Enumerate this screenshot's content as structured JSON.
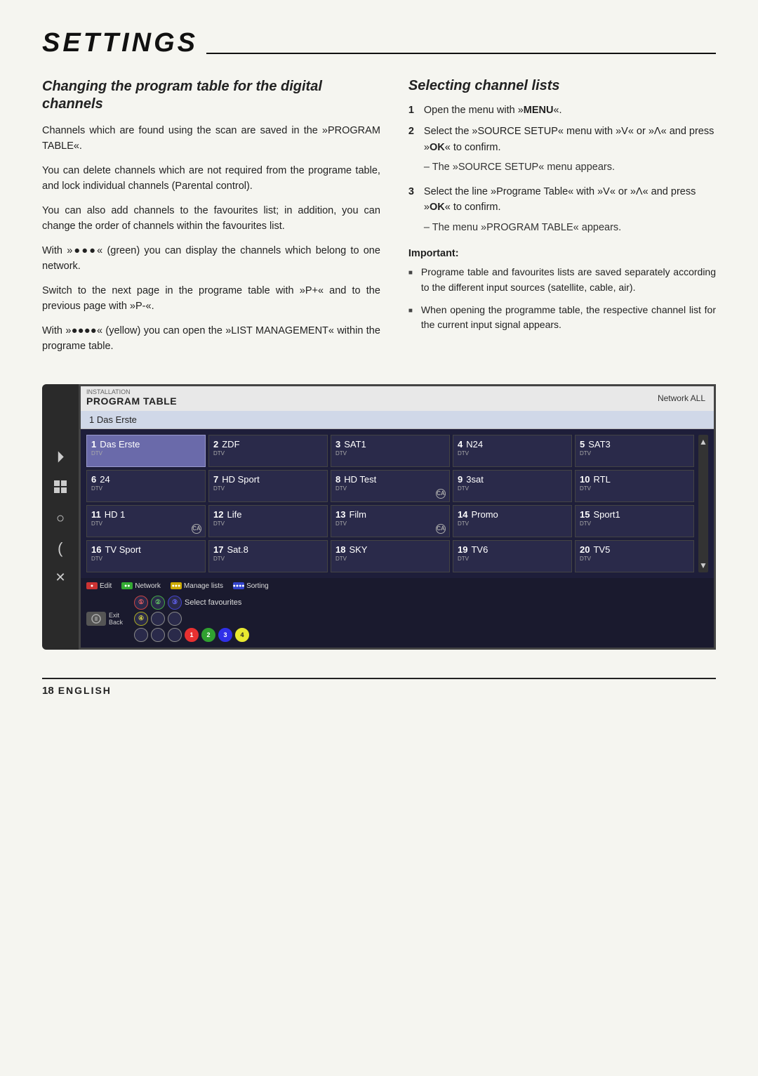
{
  "page": {
    "title": "SETTINGS",
    "footer": {
      "page_num": "18",
      "language": "ENGLISH"
    }
  },
  "left_col": {
    "heading": "Changing the program table for the digital channels",
    "paragraphs": [
      "Channels which are found using the scan are saved in the »PROGRAM TABLE«.",
      "You can delete channels which are not required from the programe table, and lock individual channels (Parental control).",
      "You can also add channels to the favourites list; in addition, you can change the order of channels within the favourites list.",
      "With »●●●« (green) you can display the channels which belong to one network.",
      "Switch to the next page in the programe table with »P+« and to the previous page with »P-«.",
      "With »●●●●« (yellow) you can open the »LIST MANAGEMENT« within the programe table."
    ]
  },
  "right_col": {
    "heading": "Selecting channel lists",
    "steps": [
      {
        "num": "1",
        "text": "Open the menu with »MENU«."
      },
      {
        "num": "2",
        "text": "Select the »SOURCE SETUP« menu with »V« or »Λ« and press »OK« to confirm.",
        "sub": "– The »SOURCE SETUP« menu appears."
      },
      {
        "num": "3",
        "text": "Select the line »Programe Table« with »V« or »Λ« and press »OK« to confirm.",
        "sub": "– The menu »PROGRAM TABLE« appears."
      }
    ],
    "important_label": "Important:",
    "bullets": [
      "Programe table and favourites lists are saved separately according to the different input sources (satellite, cable, air).",
      "When opening the programme table, the respective channel list for the current input signal appears."
    ]
  },
  "tv_screen": {
    "installation_label": "INSTALLATION",
    "program_table_label": "PROGRAM TABLE",
    "network_label": "Network ALL",
    "selected_channel": "1   Das Erste",
    "channels": [
      {
        "num": "1",
        "name": "Das Erste",
        "type": "DTV",
        "ca": false,
        "selected": true
      },
      {
        "num": "2",
        "name": "ZDF",
        "type": "DTV",
        "ca": false,
        "selected": false
      },
      {
        "num": "3",
        "name": "SAT1",
        "type": "DTV",
        "ca": false,
        "selected": false
      },
      {
        "num": "4",
        "name": "N24",
        "type": "DTV",
        "ca": false,
        "selected": false
      },
      {
        "num": "5",
        "name": "SAT3",
        "type": "DTV",
        "ca": false,
        "selected": false
      },
      {
        "num": "6",
        "name": "24",
        "type": "DTV",
        "ca": false,
        "selected": false
      },
      {
        "num": "7",
        "name": "HD Sport",
        "type": "DTV",
        "ca": false,
        "selected": false
      },
      {
        "num": "8",
        "name": "HD Test",
        "type": "DTV",
        "ca": true,
        "selected": false
      },
      {
        "num": "9",
        "name": "3sat",
        "type": "DTV",
        "ca": false,
        "selected": false
      },
      {
        "num": "10",
        "name": "RTL",
        "type": "DTV",
        "ca": false,
        "selected": false
      },
      {
        "num": "11",
        "name": "HD 1",
        "type": "DTV",
        "ca": true,
        "selected": false
      },
      {
        "num": "12",
        "name": "Life",
        "type": "DTV",
        "ca": false,
        "selected": false
      },
      {
        "num": "13",
        "name": "Film",
        "type": "DTV",
        "ca": true,
        "selected": false
      },
      {
        "num": "14",
        "name": "Promo",
        "type": "DTV",
        "ca": false,
        "selected": false
      },
      {
        "num": "15",
        "name": "Sport1",
        "type": "DTV",
        "ca": false,
        "selected": false
      },
      {
        "num": "16",
        "name": "TV Sport",
        "type": "DTV",
        "ca": false,
        "selected": false
      },
      {
        "num": "17",
        "name": "Sat.8",
        "type": "DTV",
        "ca": false,
        "selected": false
      },
      {
        "num": "18",
        "name": "SKY",
        "type": "DTV",
        "ca": false,
        "selected": false
      },
      {
        "num": "19",
        "name": "TV6",
        "type": "DTV",
        "ca": false,
        "selected": false
      },
      {
        "num": "20",
        "name": "TV5",
        "type": "DTV",
        "ca": false,
        "selected": false
      }
    ],
    "buttons": [
      {
        "color": "red",
        "label": "Edit"
      },
      {
        "color": "green",
        "label": "Network"
      },
      {
        "color": "yellow",
        "label": "Manage lists"
      },
      {
        "color": "blue",
        "label": "Sorting"
      }
    ],
    "footer": {
      "exit_label": "Exit",
      "back_label": "Back",
      "select_fav_label": "Select favourites",
      "circles": [
        {
          "label": "①",
          "type": "num",
          "val": "1",
          "color": "red"
        },
        {
          "label": "②",
          "type": "num",
          "val": "2",
          "color": "green"
        },
        {
          "label": "③",
          "type": "num",
          "val": "3",
          "color": "blue"
        },
        {
          "label": "④",
          "type": "num",
          "val": "4",
          "color": "yellow"
        }
      ],
      "bottom_circles": [
        {
          "val": "",
          "active": false
        },
        {
          "val": "",
          "active": false
        },
        {
          "val": "",
          "active": false
        },
        {
          "val": "",
          "active": false
        },
        {
          "val": "1",
          "active": true,
          "color": "num-1"
        },
        {
          "val": "2",
          "active": true,
          "color": "num-2"
        },
        {
          "val": "3",
          "active": true,
          "color": "num-3"
        },
        {
          "val": "4",
          "active": true,
          "color": "num-4"
        }
      ]
    },
    "sidebar_icons": [
      "●",
      "⊞",
      "○",
      ")",
      "✕"
    ]
  }
}
